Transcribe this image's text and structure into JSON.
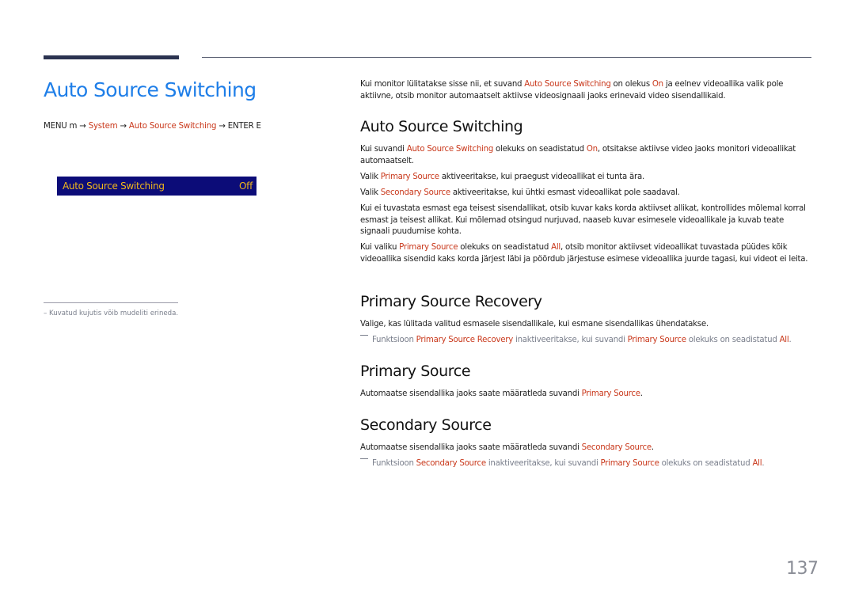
{
  "left": {
    "title": "Auto Source Switching",
    "menu_path": {
      "menu": "MENU m →",
      "system": "System",
      "arrow1": "→",
      "item": "Auto Source Switching",
      "arrow2": "→",
      "enter": "ENTER E"
    },
    "osd": {
      "label": "Auto Source Switching",
      "value": "Off"
    },
    "note": "–  Kuvatud kujutis võib mudeliti erineda."
  },
  "intro": {
    "t1": "Kui monitor lülitatakse sisse nii, et suvand ",
    "h1": "Auto Source Switching",
    "t2": " on olekus ",
    "h2": "On",
    "t3": " ja eelnev videoallika valik pole aktiivne, otsib monitor automaatselt aktiivse videosignaali jaoks erinevaid video sisendallikaid."
  },
  "sections": {
    "auto": {
      "heading": "Auto Source Switching",
      "p1": {
        "t1": "Kui suvandi ",
        "h1": "Auto Source Switching",
        "t2": " olekuks on seadistatud ",
        "h2": "On",
        "t3": ", otsitakse aktiivse video jaoks monitori videoallikat automaatselt."
      },
      "p2": {
        "t1": "Valik ",
        "h1": "Primary Source",
        "t2": " aktiveeritakse, kui praegust videoallikat ei tunta ära."
      },
      "p3": {
        "t1": "Valik ",
        "h1": "Secondary Source",
        "t2": " aktiveeritakse, kui ühtki esmast videoallikat pole saadaval."
      },
      "p4": "Kui ei tuvastata esmast ega teisest sisendallikat, otsib kuvar kaks korda aktiivset allikat, kontrollides mõlemal korral esmast ja teisest allikat. Kui mõlemad otsingud nurjuvad, naaseb kuvar esimesele videoallikale ja kuvab teate signaali puudumise kohta.",
      "p5": {
        "t1": "Kui valiku ",
        "h1": "Primary Source",
        "t2": " olekuks on seadistatud ",
        "h2": "All",
        "t3": ", otsib monitor aktiivset videoallikat tuvastada püüdes kõik videoallika sisendid kaks korda järjest läbi ja pöördub järjestuse esimese videoallika juurde tagasi, kui videot ei leita."
      }
    },
    "recovery": {
      "heading": "Primary Source Recovery",
      "p1": "Valige, kas lülitada valitud esmasele sisendallikale, kui esmane sisendallikas ühendatakse.",
      "tip": {
        "t1": "Funktsioon ",
        "h1": "Primary Source Recovery",
        "t2": " inaktiveeritakse, kui suvandi ",
        "h2": "Primary Source",
        "t3": " olekuks on seadistatud ",
        "h3": "All",
        "t4": "."
      }
    },
    "primary": {
      "heading": "Primary Source",
      "p1": {
        "t1": "Automaatse sisendallika jaoks saate määratleda suvandi ",
        "h1": "Primary Source",
        "t2": "."
      }
    },
    "secondary": {
      "heading": "Secondary Source",
      "p1": {
        "t1": "Automaatse sisendallika jaoks saate määratleda suvandi ",
        "h1": "Secondary Source",
        "t2": "."
      },
      "tip": {
        "t1": "Funktsioon ",
        "h1": "Secondary Source",
        "t2": " inaktiveeritakse, kui suvandi ",
        "h2": "Primary Source",
        "t3": " olekuks on seadistatud ",
        "h3": "All",
        "t4": "."
      }
    }
  },
  "page_number": "137",
  "colors": {
    "title_blue": "#1e7ee8",
    "highlight_red": "#c9381b",
    "osd_bg": "#0c0c78",
    "osd_text": "#f2b81b",
    "header_bar": "#2b3350"
  }
}
